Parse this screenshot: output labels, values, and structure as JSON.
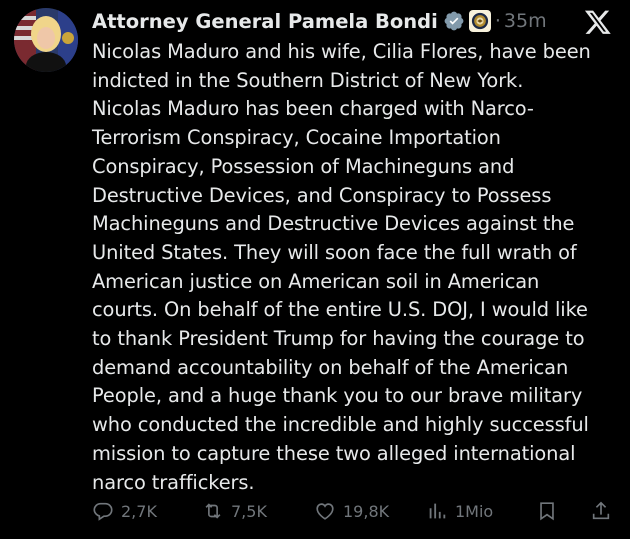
{
  "tweet": {
    "author_name": "Attorney General Pamela Bondi",
    "timestamp": "35m",
    "separator": "·",
    "text": "Nicolas Maduro and his wife, Cilia Flores, have been\nindicted in the Southern District of New York.\nNicolas Maduro has been charged with Narco-\nTerrorism Conspiracy, Cocaine Importation\nConspiracy, Possession of Machineguns and\nDestructive Devices, and Conspiracy to Possess\nMachineguns and Destructive Devices against the\nUnited States.  They will soon face the full wrath of\nAmerican justice on American soil in American\ncourts. On behalf of the entire U.S. DOJ, I would like\nto thank President Trump for having the courage to\ndemand accountability on behalf of the American\nPeople, and a huge thank you to our brave military\nwho conducted the incredible and highly successful\nmission to capture these two alleged international\nnarco traffickers."
  },
  "actions": {
    "replies": "2,7K",
    "reposts": "7,5K",
    "likes": "19,8K",
    "views": "1Mio"
  },
  "icons": {
    "verified": "gray-verified-badge-icon",
    "affiliate": "doj-seal-icon",
    "logo": "x-logo-icon",
    "reply": "reply-icon",
    "repost": "repost-icon",
    "like": "heart-icon",
    "views": "views-chart-icon",
    "bookmark": "bookmark-icon",
    "share": "share-icon"
  },
  "colors": {
    "background": "#000000",
    "text": "#e7e9ea",
    "muted": "#71767b",
    "verified_gray": "#829aab"
  }
}
